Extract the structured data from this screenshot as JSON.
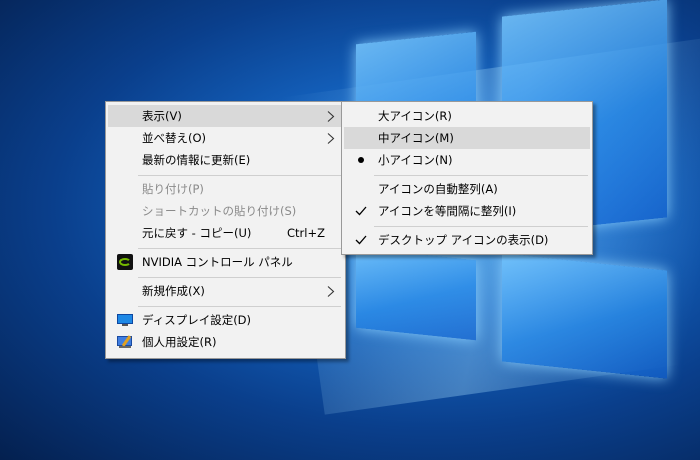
{
  "main_menu": {
    "items": [
      {
        "label": "表示(V)",
        "accel": "",
        "submenu": true,
        "highlighted": true,
        "disabled": false
      },
      {
        "label": "並べ替え(O)",
        "accel": "",
        "submenu": true,
        "highlighted": false,
        "disabled": false
      },
      {
        "label": "最新の情報に更新(E)",
        "accel": "",
        "submenu": false,
        "highlighted": false,
        "disabled": false
      },
      {
        "label": "貼り付け(P)",
        "accel": "",
        "submenu": false,
        "highlighted": false,
        "disabled": true
      },
      {
        "label": "ショートカットの貼り付け(S)",
        "accel": "",
        "submenu": false,
        "highlighted": false,
        "disabled": true
      },
      {
        "label": "元に戻す - コピー(U)",
        "accel": "Ctrl+Z",
        "submenu": false,
        "highlighted": false,
        "disabled": false
      },
      {
        "label": "NVIDIA コントロール パネル",
        "accel": "",
        "submenu": false,
        "highlighted": false,
        "disabled": false,
        "icon": "nvidia-icon"
      },
      {
        "label": "新規作成(X)",
        "accel": "",
        "submenu": true,
        "highlighted": false,
        "disabled": false
      },
      {
        "label": "ディスプレイ設定(D)",
        "accel": "",
        "submenu": false,
        "highlighted": false,
        "disabled": false,
        "icon": "display-settings-icon"
      },
      {
        "label": "個人用設定(R)",
        "accel": "",
        "submenu": false,
        "highlighted": false,
        "disabled": false,
        "icon": "personalize-icon"
      }
    ]
  },
  "sub_menu": {
    "items": [
      {
        "label": "大アイコン(R)",
        "mark": "none",
        "highlighted": false
      },
      {
        "label": "中アイコン(M)",
        "mark": "none",
        "highlighted": true
      },
      {
        "label": "小アイコン(N)",
        "mark": "radio-dot",
        "highlighted": false
      },
      {
        "label": "アイコンの自動整列(A)",
        "mark": "none",
        "highlighted": false
      },
      {
        "label": "アイコンを等間隔に整列(I)",
        "mark": "check",
        "highlighted": false
      },
      {
        "label": "デスクトップ アイコンの表示(D)",
        "mark": "check",
        "highlighted": false
      }
    ]
  },
  "colors": {
    "menu_background": "#f2f2f2",
    "highlight": "#d9d9d9",
    "disabled_text": "#8a8a8a",
    "desktop_blue": "#1566c4"
  }
}
